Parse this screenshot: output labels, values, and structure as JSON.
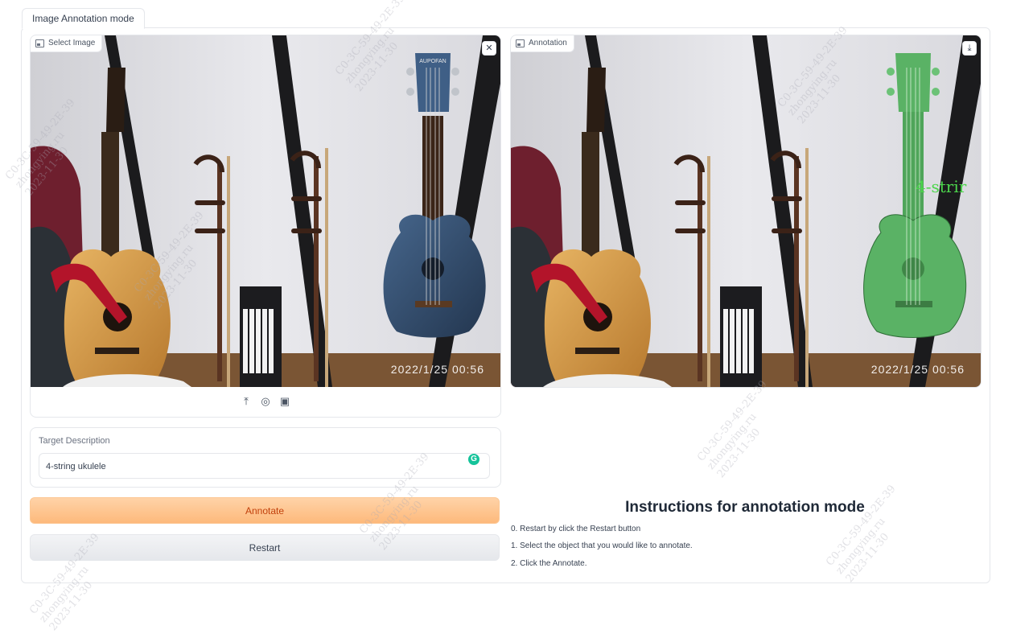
{
  "tab": {
    "label": "Image Annotation mode"
  },
  "input_panel": {
    "label": "Select Image",
    "close_icon": "close-icon",
    "timestamp": "2022/1/25 00:56",
    "headstock_text": "AUPOFAN",
    "toolbar_icons": [
      "upload-icon",
      "webcam-icon",
      "clipboard-icon"
    ]
  },
  "output_panel": {
    "label": "Annotation",
    "download_icon": "download-icon",
    "timestamp": "2022/1/25 00:56",
    "annotation_text": "4-strir",
    "mask_color": "#5ab265"
  },
  "target": {
    "label": "Target Description",
    "value": "4-string ukulele"
  },
  "buttons": {
    "annotate": "Annotate",
    "restart": "Restart"
  },
  "instructions": {
    "title": "Instructions for annotation mode",
    "items": [
      "0. Restart by click the Restart button",
      "1. Select the object that you would like to annotate.",
      "2. Click the Annotate."
    ]
  },
  "watermark": {
    "line1": "C0-3C-59-49-2E-39",
    "line2": "zhongying.ru",
    "line3": "2023-11-30"
  },
  "colors": {
    "accent": "#fdb97b",
    "accent_text": "#c2410c",
    "border": "#e5e7eb"
  }
}
